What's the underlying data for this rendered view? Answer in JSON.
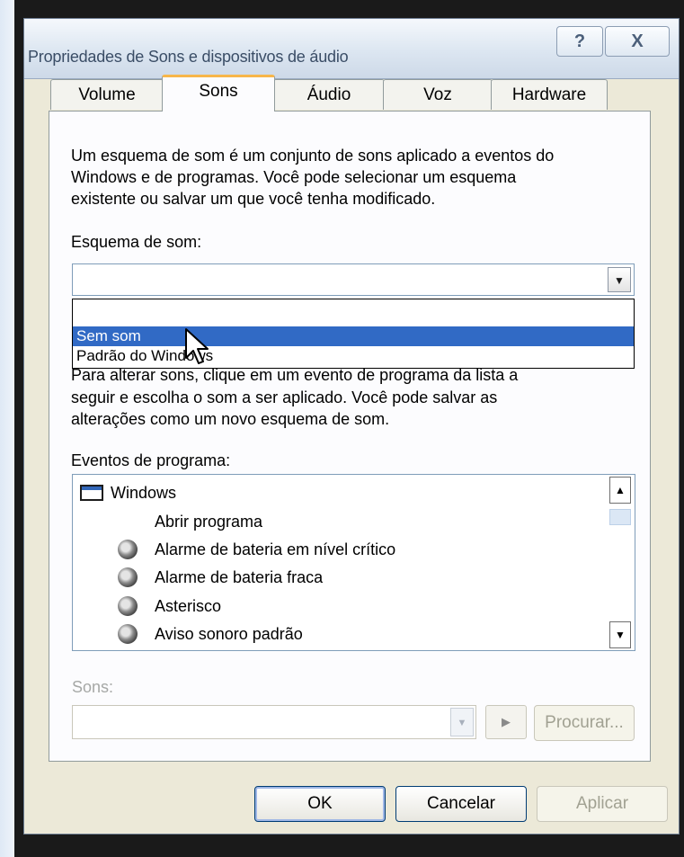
{
  "window": {
    "title": "Propriedades de Sons e dispositivos de áudio",
    "help_label": "?",
    "close_label": "X"
  },
  "tabs": [
    {
      "label": "Volume"
    },
    {
      "label": "Sons",
      "active": true
    },
    {
      "label": "Áudio"
    },
    {
      "label": "Voz"
    },
    {
      "label": "Hardware"
    }
  ],
  "sons_tab": {
    "intro_lines": [
      "Um esquema de som é um conjunto de sons aplicado a eventos do",
      "Windows e de programas. Você pode selecionar um esquema",
      "existente ou salvar um que você tenha modificado."
    ],
    "scheme_label": "Esquema de som:",
    "scheme_value": "",
    "scheme_options": [
      {
        "label": "",
        "selected": false
      },
      {
        "label": "Sem som",
        "selected": true
      },
      {
        "label": "Padrão do Windows",
        "selected": false
      }
    ],
    "change_lines": [
      "Para alterar sons, clique em um evento de programa da lista a",
      "seguir e escolha o som a ser aplicado. Você pode salvar as",
      "alterações como um novo esquema de som."
    ],
    "events_label": "Eventos de programa:",
    "events": [
      {
        "label": "Windows",
        "icon": "window-icon",
        "indent": 0
      },
      {
        "label": "Abrir programa",
        "icon": "none",
        "indent": 1
      },
      {
        "label": "Alarme de bateria em nível crítico",
        "icon": "speaker-icon",
        "indent": 1
      },
      {
        "label": "Alarme de bateria fraca",
        "icon": "speaker-icon",
        "indent": 1
      },
      {
        "label": "Asterisco",
        "icon": "speaker-icon",
        "indent": 1
      },
      {
        "label": "Aviso sonoro padrão",
        "icon": "speaker-icon",
        "indent": 1
      }
    ],
    "sounds_label": "Sons:",
    "sounds_value": "",
    "browse_label": "Procurar..."
  },
  "footer": {
    "ok_label": "OK",
    "cancel_label": "Cancelar",
    "apply_label": "Aplicar"
  },
  "colors": {
    "selection": "#316ac5",
    "face": "#ece9d8",
    "active_tab_accent": "#f7b64a"
  }
}
